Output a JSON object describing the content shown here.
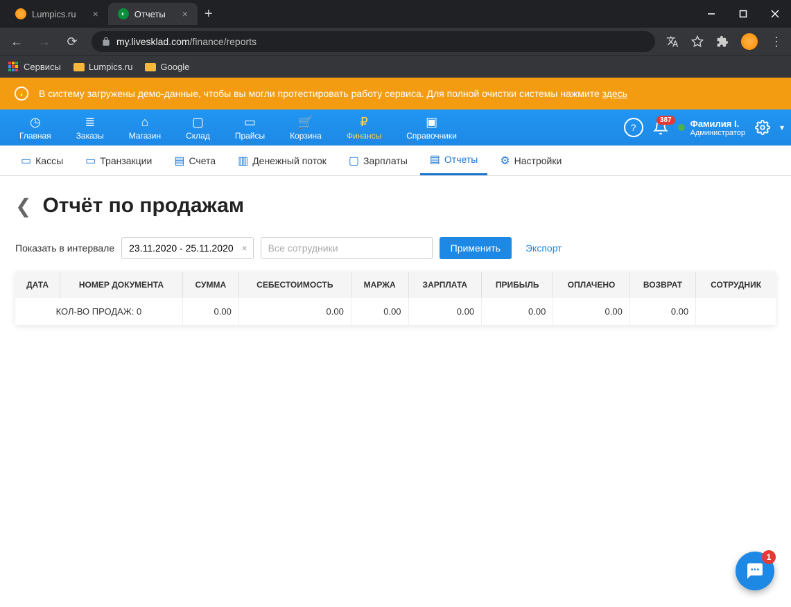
{
  "browser": {
    "tabs": [
      {
        "title": "Lumpics.ru",
        "active": false
      },
      {
        "title": "Отчеты",
        "active": true
      }
    ],
    "url_host": "my.livesklad.com",
    "url_path": "/finance/reports",
    "bookmarks": [
      {
        "label": "Сервисы"
      },
      {
        "label": "Lumpics.ru"
      },
      {
        "label": "Google"
      }
    ]
  },
  "banner": {
    "text": "В систему загружены демо-данные, чтобы вы могли протестировать работу сервиса. Для полной очистки системы нажмите ",
    "link": "здесь"
  },
  "main_nav": {
    "items": [
      {
        "label": "Главная"
      },
      {
        "label": "Заказы"
      },
      {
        "label": "Магазин"
      },
      {
        "label": "Склад"
      },
      {
        "label": "Прайсы"
      },
      {
        "label": "Корзина"
      },
      {
        "label": "Финансы",
        "active": true
      },
      {
        "label": "Справочники"
      }
    ],
    "notification_count": "387",
    "user_name": "Фамилия I.",
    "user_role": "Администратор"
  },
  "sub_nav": {
    "items": [
      {
        "label": "Кассы"
      },
      {
        "label": "Транзакции"
      },
      {
        "label": "Счета"
      },
      {
        "label": "Денежный поток"
      },
      {
        "label": "Зарплаты"
      },
      {
        "label": "Отчеты",
        "active": true
      },
      {
        "label": "Настройки"
      }
    ]
  },
  "page": {
    "title": "Отчёт по продажам",
    "filter_label": "Показать в интервале",
    "date_range": "23.11.2020 - 25.11.2020",
    "employee_placeholder": "Все сотрудники",
    "apply_label": "Применить",
    "export_label": "Экспорт"
  },
  "table": {
    "columns": [
      "ДАТА",
      "НОМЕР ДОКУМЕНТА",
      "СУММА",
      "СЕБЕСТОИМОСТЬ",
      "МАРЖА",
      "ЗАРПЛАТА",
      "ПРИБЫЛЬ",
      "ОПЛАЧЕНО",
      "ВОЗВРАТ",
      "СОТРУДНИК"
    ],
    "summary_label": "КОЛ-ВО ПРОДАЖ: 0",
    "summary": [
      "0.00",
      "0.00",
      "0.00",
      "0.00",
      "0.00",
      "0.00",
      "0.00",
      ""
    ]
  },
  "chat_badge": "1"
}
